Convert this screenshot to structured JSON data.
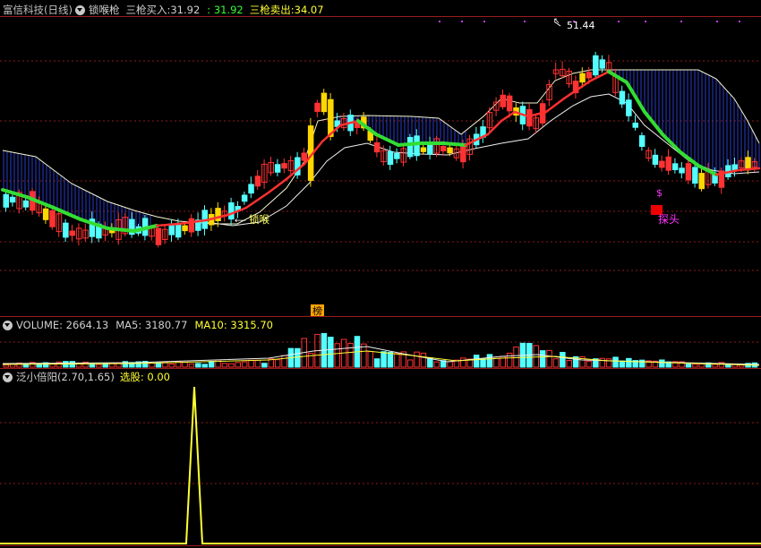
{
  "main_panel": {
    "stock_name": "富信科技(日线)",
    "indicator_name": "锁喉枪",
    "buy_label": "三枪买入: ",
    "buy_value": "31.92",
    "buy_value2": ": 31.92",
    "sell_label": "三枪卖出: ",
    "sell_value": "34.07",
    "peak_label": "51.44",
    "lock_label": "锁喉",
    "dollar_mark": "$",
    "probe_label": "探头",
    "rank_badge": "榜"
  },
  "volume_panel": {
    "title": "VOLUME: 2664.13",
    "ma5": "MA5: 3180.77",
    "ma10": "MA10: 3315.70"
  },
  "sub_panel": {
    "title": "泛小倍阳(2.70,1.65)",
    "pick_label": "选股: 0.00"
  },
  "colors": {
    "background": "#000000",
    "up_candle": "#ff3232",
    "down_candle": "#54ffff",
    "yellow_candle": "#ffd700",
    "green_line": "#33dd33",
    "red_line": "#ff3030",
    "grid": "#8b1a1a",
    "fill_lines": "#2a3dcc"
  }
}
